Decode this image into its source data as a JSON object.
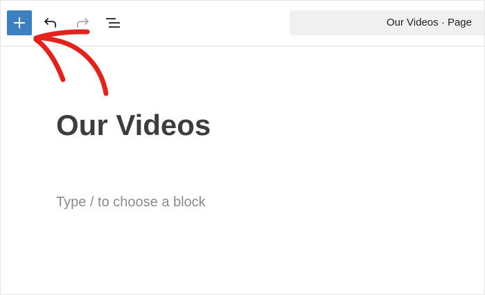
{
  "toolbar": {
    "inserter_icon": "plus-icon",
    "undo_icon": "undo-icon",
    "redo_icon": "redo-icon",
    "outline_icon": "list-view-icon",
    "accent_color": "#3d7fbf"
  },
  "document_bar": {
    "title": "Our Videos · Page"
  },
  "editor": {
    "page_title": "Our Videos",
    "block_placeholder": "Type / to choose a block"
  },
  "annotation": {
    "icon": "hand-drawn-arrow-icon",
    "color": "#e3231b"
  }
}
